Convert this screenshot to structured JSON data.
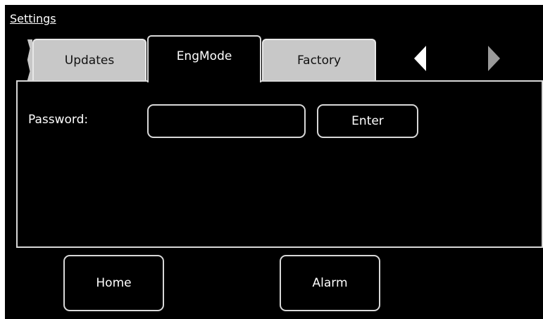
{
  "header": {
    "title": "Settings"
  },
  "tabs": [
    {
      "label": "Updates",
      "active": false
    },
    {
      "label": "EngMode",
      "active": true
    },
    {
      "label": "Factory",
      "active": false
    }
  ],
  "tab_nav": {
    "prev_icon": "triangle-left-icon",
    "next_icon": "triangle-right-icon"
  },
  "engmode": {
    "password_label": "Password:",
    "password_value": "",
    "password_placeholder": "",
    "enter_label": "Enter"
  },
  "footer": {
    "home_label": "Home",
    "alarm_label": "Alarm"
  },
  "colors": {
    "background": "#000000",
    "foreground": "#ffffff",
    "inactive_tab": "#c8c8c8",
    "border": "#d8d8d8",
    "disabled_arrow": "#9a9a9a"
  }
}
